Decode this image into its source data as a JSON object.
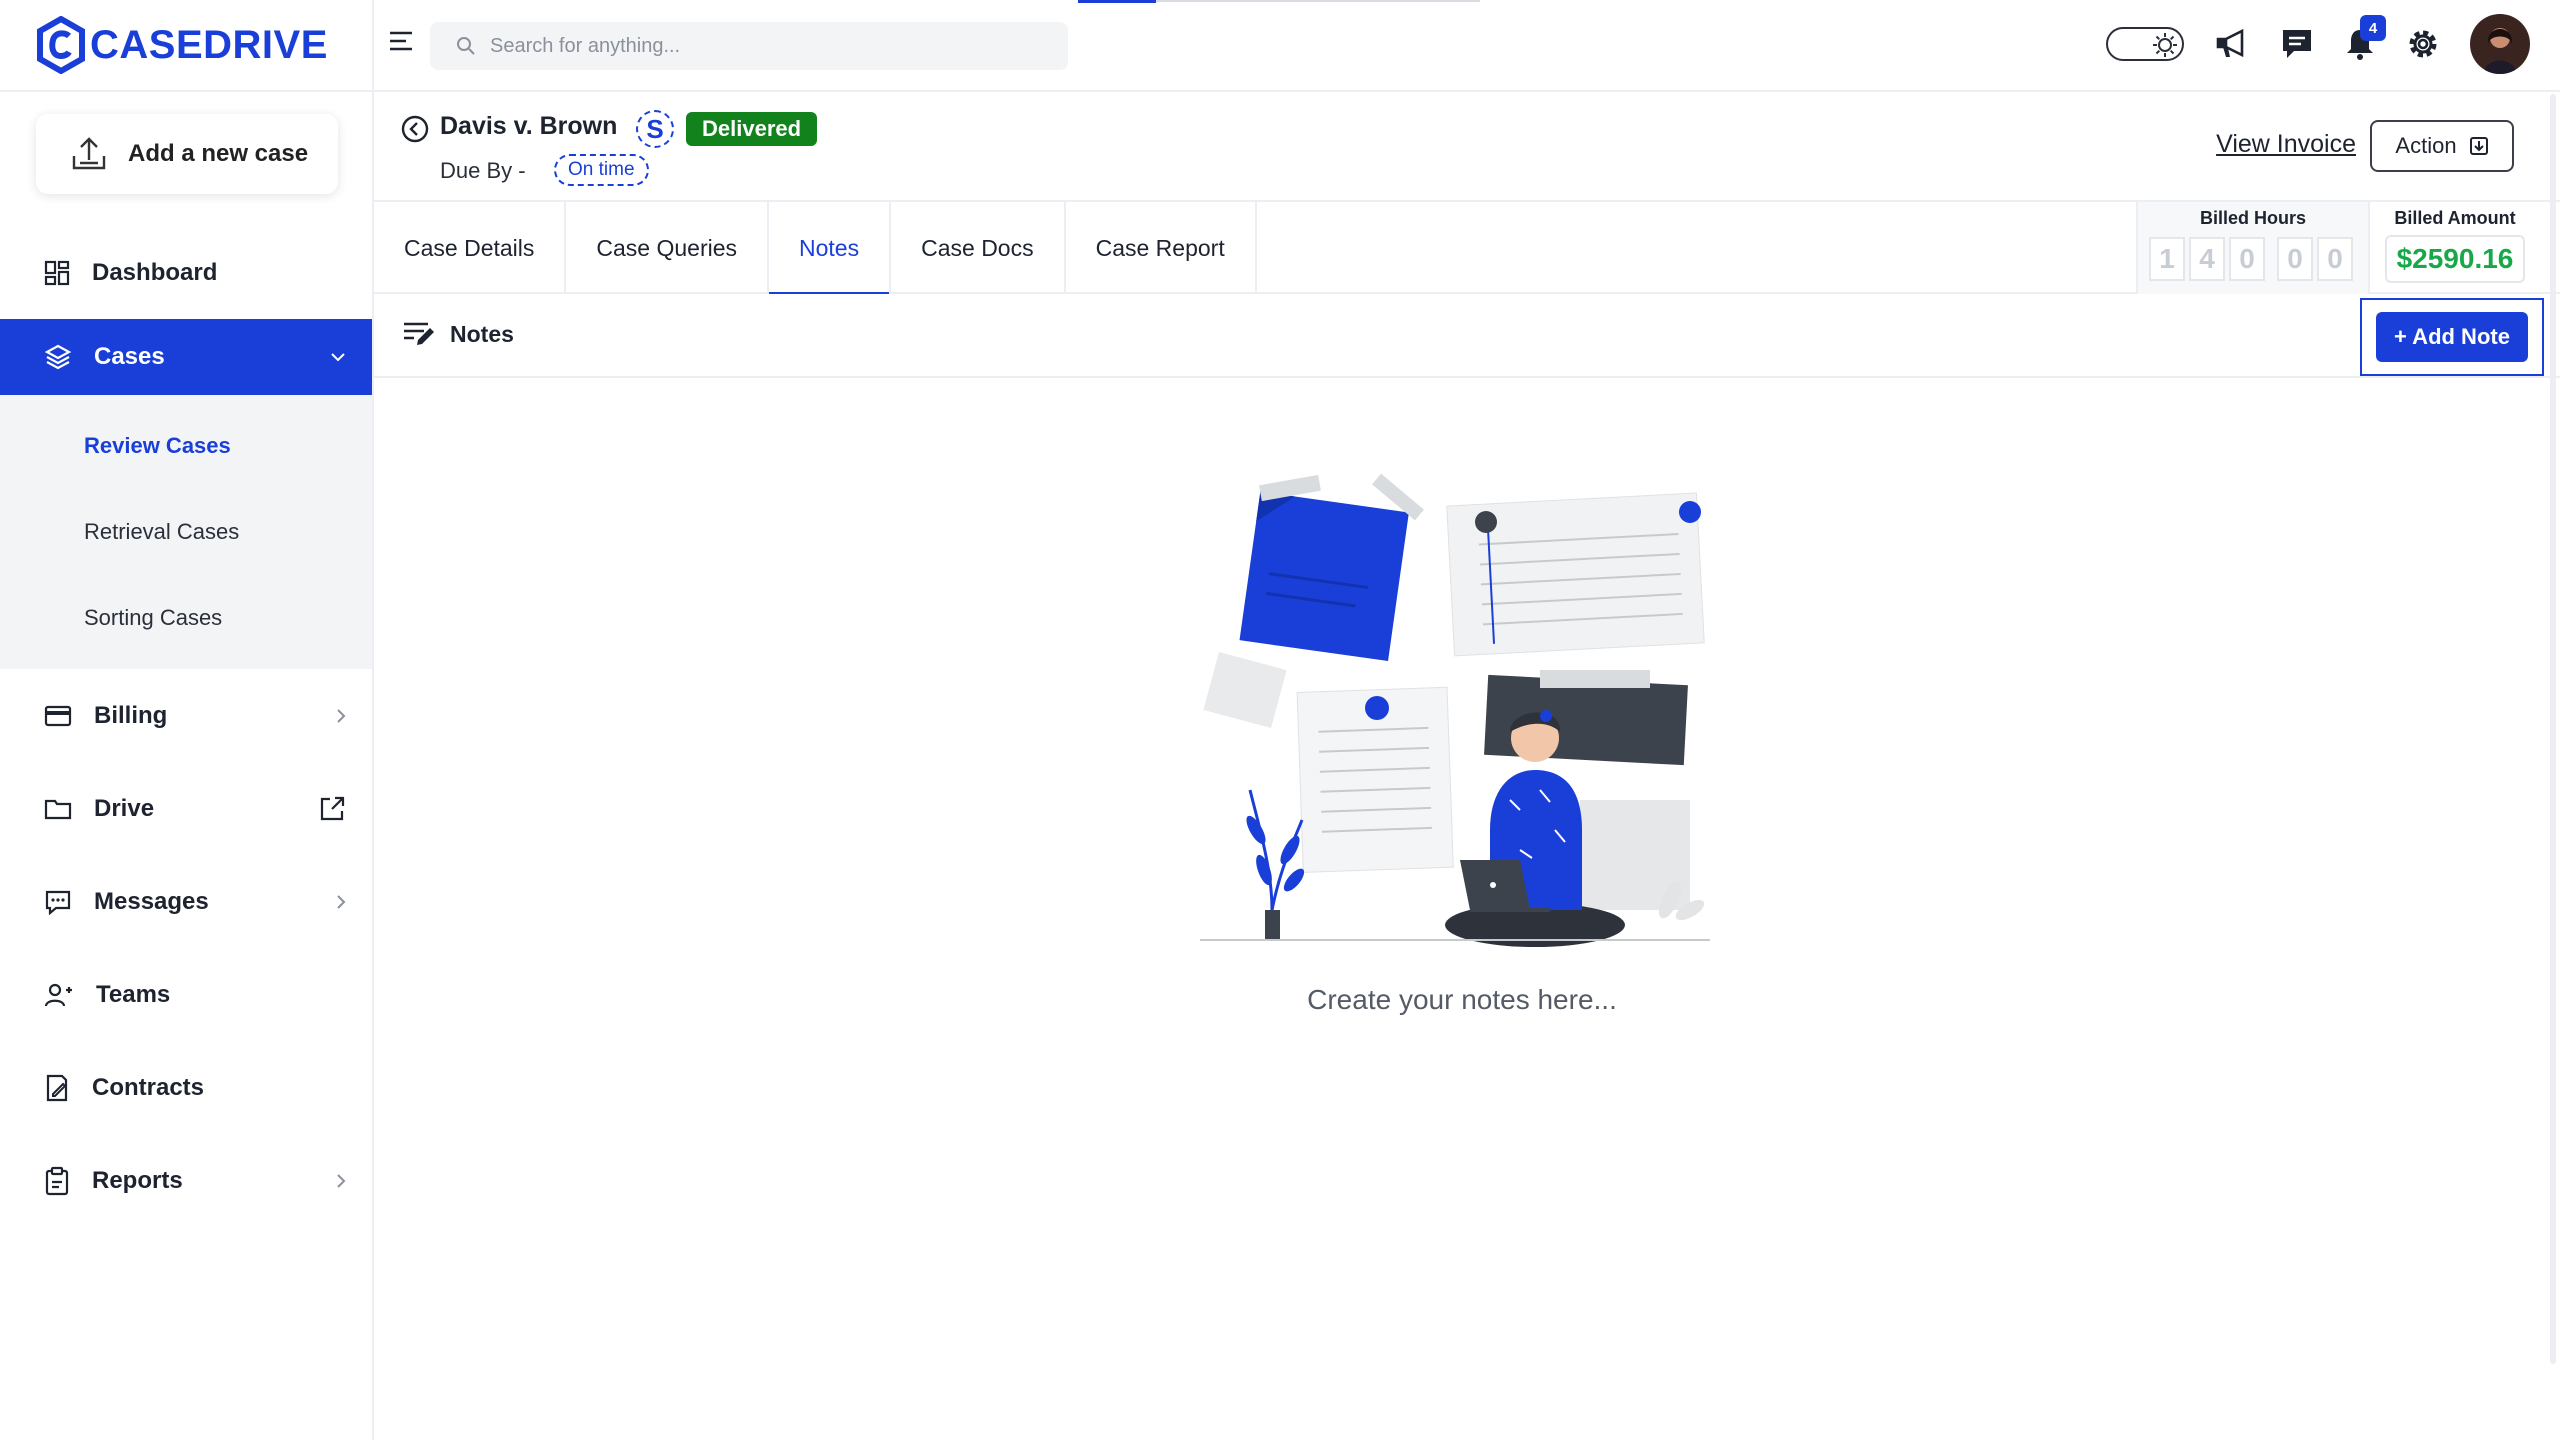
{
  "brand": {
    "logo_text": "CASEDRIVE",
    "accent": "#1a3fd9"
  },
  "sidebar": {
    "add_case_label": "Add a new case",
    "items": [
      {
        "label": "Dashboard",
        "icon": "dashboard-icon"
      },
      {
        "label": "Cases",
        "icon": "layers-icon",
        "active": true
      },
      {
        "label": "Billing",
        "icon": "credit-card-icon"
      },
      {
        "label": "Drive",
        "icon": "folder-icon"
      },
      {
        "label": "Messages",
        "icon": "message-icon"
      },
      {
        "label": "Teams",
        "icon": "users-icon"
      },
      {
        "label": "Contracts",
        "icon": "contract-icon"
      },
      {
        "label": "Reports",
        "icon": "clipboard-icon"
      }
    ],
    "cases_submenu": [
      "Review Cases",
      "Retrieval Cases",
      "Sorting Cases"
    ]
  },
  "topbar": {
    "search_placeholder": "Search for anything...",
    "notification_count": "4"
  },
  "case": {
    "title": "Davis v. Brown",
    "s_badge": "S",
    "status": "Delivered",
    "status_color": "#11821c",
    "due_label": "Due By -",
    "due_status": "On time",
    "view_invoice_label": "View Invoice",
    "action_label": "Action"
  },
  "tabs": [
    "Case Details",
    "Case Queries",
    "Notes",
    "Case Docs",
    "Case Report"
  ],
  "billing": {
    "hours_label": "Billed Hours",
    "hours_digits": [
      "1",
      "4",
      "0",
      "0",
      "0"
    ],
    "amount_label": "Billed Amount",
    "amount": "$2590.16",
    "amount_color": "#18a84a"
  },
  "notes": {
    "section_title": "Notes",
    "add_label": "+ Add Note",
    "empty_text": "Create your notes here..."
  }
}
